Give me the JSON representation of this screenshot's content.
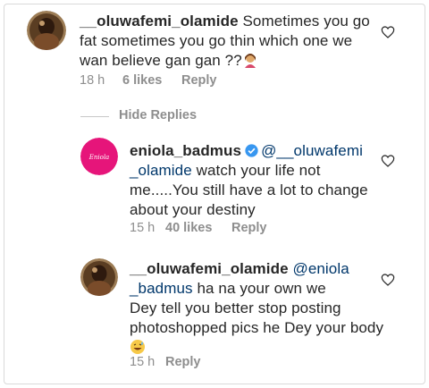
{
  "comments": [
    {
      "username": "__oluwafemi_olamide",
      "text_line1": "Sometimes you go",
      "text_line2": "fat sometimes you go thin which one we",
      "text_line3": "wan believe gan gan ??",
      "emoji_icon": "woman-tipping-hand-emoji",
      "time": "18 h",
      "likes": "6 likes",
      "reply": "Reply"
    }
  ],
  "hide_replies": "Hide Replies",
  "replies": [
    {
      "username": "eniola_badmus",
      "verified": true,
      "mention_line1": "@__oluwafemi",
      "mention_line2": "_olamide",
      "text_line2": " watch your life not",
      "text_line3": "me.....You still have a lot to change",
      "text_line4": "about your destiny",
      "time": "15 h",
      "likes": "40 likes",
      "reply": "Reply"
    },
    {
      "username": "__oluwafemi_olamide",
      "mention_line1": "@eniola",
      "mention_line2": "_badmus",
      "text_line2": " ha na your own we",
      "text_line3": "Dey tell you better stop posting",
      "text_line4": "photoshopped pics he Dey your body",
      "emoji_icon": "grinning-sweat-emoji",
      "time": "15 h",
      "reply": "Reply"
    }
  ],
  "colors": {
    "text": "#262626",
    "meta": "#8e8e8e",
    "mention": "#00376b",
    "verified": "#3897f0",
    "brand_avatar": "#e6157a"
  }
}
